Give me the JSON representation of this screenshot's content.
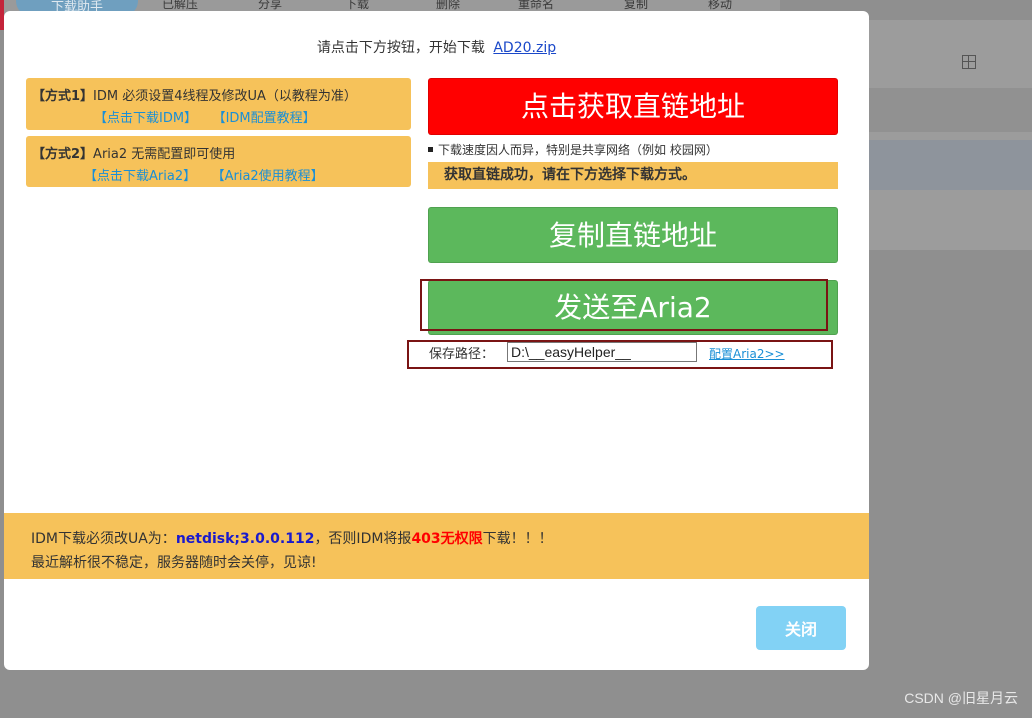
{
  "background": {
    "pill_label": "下载助手",
    "toolbar_items": [
      "已解压",
      "分享",
      "下载",
      "删除",
      "重命名",
      "复制",
      "移动"
    ]
  },
  "modal": {
    "title_prefix": "请点击下方按钮，开始下载",
    "file_name": "AD20.zip",
    "method1": {
      "tag": "【方式1】",
      "text": "IDM 必须设置4线程及修改UA（以教程为准）",
      "link1": "【点击下载IDM】",
      "link2": "【IDM配置教程】"
    },
    "method2": {
      "tag": "【方式2】",
      "text": "Aria2 无需配置即可使用",
      "link1": "【点击下载Aria2】",
      "link2": "【Aria2使用教程】"
    },
    "get_link_button": "点击获取直链地址",
    "speed_note": "下载速度因人而异，特别是共享网络（例如 校园网）",
    "success_message": "获取直链成功，请在下方选择下载方式。",
    "copy_link_button": "复制直链地址",
    "send_aria2_button": "发送至Aria2",
    "save_path_label": "保存路径：",
    "save_path_value": "D:\\__easyHelper__",
    "config_aria2_link": "配置Aria2>>",
    "notice": {
      "line1_prefix": "IDM下载必须改UA为：",
      "ua_value": "netdisk;3.0.0.112",
      "line1_mid": "，否则IDM将报",
      "deny_text": "403无权限",
      "line1_suffix": "下载！！！",
      "line2": "最近解析很不稳定，服务器随时会关停，见谅!"
    },
    "close_button": "关闭"
  },
  "watermark": "CSDN @旧星月云",
  "colors": {
    "red_button": "#ff0000",
    "green_button": "#5cb85c",
    "notice_yellow": "#f6c25a",
    "link_blue": "#1a8fd6",
    "close_button": "#82d2f5",
    "highlight_border": "#7a1414"
  }
}
